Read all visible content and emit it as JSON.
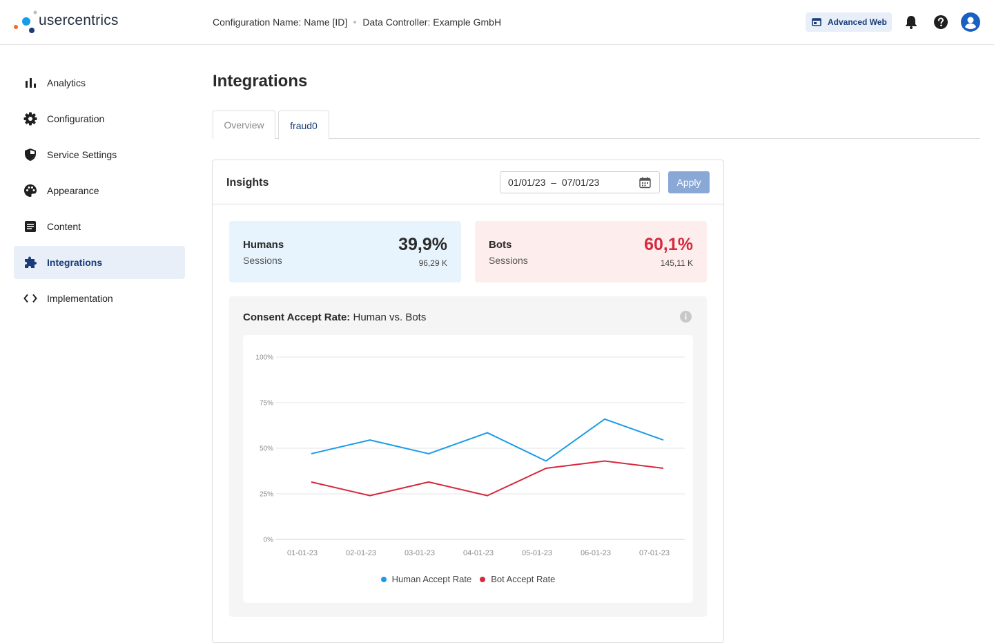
{
  "brand": {
    "name": "usercentrics"
  },
  "header": {
    "config_name": "Configuration Name: Name [ID]",
    "data_controller": "Data Controller: Example GmbH",
    "plan_button": "Advanced Web"
  },
  "sidebar": {
    "items": [
      {
        "label": "Analytics",
        "icon": "bar-chart-icon",
        "active": false
      },
      {
        "label": "Configuration",
        "icon": "gear-icon",
        "active": false
      },
      {
        "label": "Service Settings",
        "icon": "shield-icon",
        "active": false
      },
      {
        "label": "Appearance",
        "icon": "palette-icon",
        "active": false
      },
      {
        "label": "Content",
        "icon": "document-icon",
        "active": false
      },
      {
        "label": "Integrations",
        "icon": "puzzle-icon",
        "active": true
      },
      {
        "label": "Implementation",
        "icon": "code-icon",
        "active": false
      }
    ]
  },
  "main": {
    "title": "Integrations",
    "tabs": [
      {
        "label": "Overview",
        "active": false
      },
      {
        "label": "fraud0",
        "active": true
      }
    ],
    "insights": {
      "title": "Insights",
      "date_range": "01/01/23  –  07/01/23",
      "apply": "Apply"
    },
    "stats": {
      "humans": {
        "label": "Humans",
        "sub": "Sessions",
        "pct": "39,9%",
        "count": "96,29 K"
      },
      "bots": {
        "label": "Bots",
        "sub": "Sessions",
        "pct": "60,1%",
        "count": "145,11 K"
      }
    },
    "chart_title_bold": "Consent Accept Rate:",
    "chart_title_rest": " Human vs. Bots"
  },
  "colors": {
    "accent": "#1a3c78",
    "human": "#1a9be8",
    "bot": "#d42a3c",
    "apply": "#8aa8d6"
  },
  "chart_data": {
    "type": "line",
    "categories": [
      "01-01-23",
      "02-01-23",
      "03-01-23",
      "04-01-23",
      "05-01-23",
      "06-01-23",
      "07-01-23"
    ],
    "series": [
      {
        "name": "Human Accept Rate",
        "values": [
          47,
          54.5,
          47,
          58.5,
          43,
          66,
          54.5
        ],
        "color": "#1a9be8"
      },
      {
        "name": "Bot Accept Rate",
        "values": [
          31.5,
          24,
          31.5,
          24,
          39,
          43,
          39
        ],
        "color": "#d42a3c"
      }
    ],
    "yticks": [
      "100%",
      "75%",
      "50%",
      "25%",
      "0%"
    ],
    "ylim": [
      0,
      100
    ],
    "grid": true,
    "legend": "bottom"
  }
}
